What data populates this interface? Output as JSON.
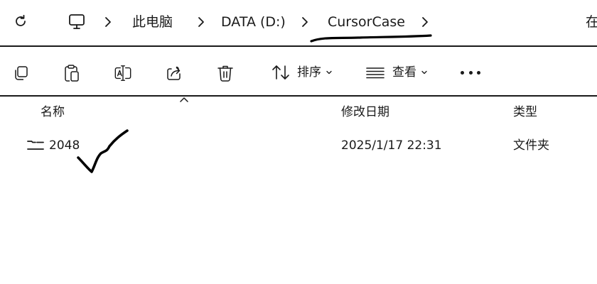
{
  "addressbar": {
    "refresh_icon": "refresh-icon",
    "computer_icon": "monitor-icon",
    "breadcrumbs": [
      "此电脑",
      "DATA (D:)",
      "CursorCase"
    ],
    "cut_off_text": "在"
  },
  "toolbar": {
    "copy_icon": "copy-icon",
    "paste_icon": "paste-icon",
    "rename_icon": "rename-icon",
    "share_icon": "share-icon",
    "delete_icon": "trash-icon",
    "sort_label": "排序",
    "view_label": "查看",
    "more_icon": "more-icon"
  },
  "columns": {
    "name": "名称",
    "modified": "修改日期",
    "type": "类型"
  },
  "files": [
    {
      "name": "2048",
      "modified": "2025/1/17 22:31",
      "type": "文件夹",
      "icon": "folder-icon"
    }
  ],
  "colors": {
    "text": "#1a1a1a",
    "background": "#ffffff",
    "annotation_ink": "#000000"
  }
}
